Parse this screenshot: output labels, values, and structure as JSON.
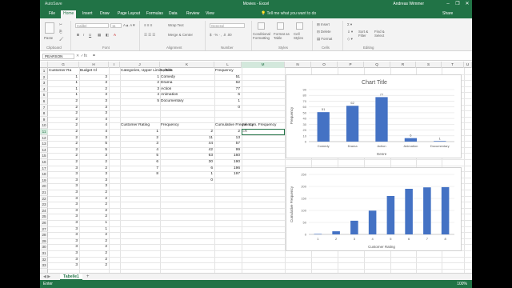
{
  "window": {
    "title": "Movies - Excel",
    "user": "Andreas Wimmer",
    "autosave": "AutoSave",
    "share": "Share",
    "tell_me": "Tell me what you want to do"
  },
  "ribbon_tabs": [
    "File",
    "Home",
    "Insert",
    "Draw",
    "Page Layout",
    "Formulas",
    "Data",
    "Review",
    "View"
  ],
  "ribbon": {
    "font_name": "Calibri",
    "font_size": "11",
    "number_format": "General",
    "wrap_text": "Wrap Text",
    "merge": "Merge & Center",
    "paste": "Paste",
    "conditional": "Conditional Formatting",
    "format_table": "Format as Table",
    "cell_styles": "Cell Styles",
    "insert": "Insert",
    "delete": "Delete",
    "format": "Format",
    "sort_filter": "Sort & Filter",
    "find_select": "Find & Select",
    "groups": [
      "Clipboard",
      "Font",
      "Alignment",
      "Number",
      "Styles",
      "Cells",
      "Editing"
    ]
  },
  "formula_bar": {
    "name_box": "PEARSON",
    "fx": "fx",
    "content": "="
  },
  "columns": [
    "G",
    "H",
    "I",
    "J",
    "K",
    "L",
    "M",
    "N",
    "O",
    "P",
    "Q",
    "R",
    "S",
    "T",
    "U"
  ],
  "rows": [
    "1",
    "2",
    "3",
    "4",
    "5",
    "6",
    "7",
    "8",
    "9",
    "10",
    "11",
    "12",
    "13",
    "14",
    "15",
    "16",
    "17",
    "18",
    "19",
    "20",
    "21",
    "22",
    "23",
    "24",
    "25",
    "26",
    "27",
    "28",
    "29",
    "30",
    "31",
    "32",
    "33"
  ],
  "headers": {
    "g1": "Customer Ra",
    "h1": "Budget Cl",
    "j1": "Categories, Upper Limits, Bins",
    "k1": "Labels",
    "l1": "Frequency",
    "j10": "Customer Rating",
    "k10": "Frequency",
    "l10": "Cumulative Frequency",
    "m10": "rel. cum. Frequency"
  },
  "customer_rating": [
    "1",
    "1",
    "1",
    "1",
    "2",
    "2",
    "2",
    "2",
    "2",
    "2",
    "2",
    "2",
    "2",
    "2",
    "2",
    "3",
    "3",
    "3",
    "3",
    "3",
    "3",
    "3",
    "3",
    "3",
    "3",
    "3",
    "3",
    "3",
    "3",
    "3",
    "3",
    "3"
  ],
  "budget_class": [
    "3",
    "3",
    "2",
    "3",
    "3",
    "3",
    "3",
    "4",
    "4",
    "4",
    "3",
    "5",
    "5",
    "3",
    "2",
    "2",
    "3",
    "3",
    "3",
    "2",
    "2",
    "2",
    "2",
    "2",
    "1",
    "1",
    "2",
    "2",
    "2",
    "2",
    "2",
    "2"
  ],
  "genre_table": {
    "bins": [
      "1",
      "2",
      "3",
      "4",
      "5"
    ],
    "labels": [
      "Comedy",
      "Drama",
      "Action",
      "Animation",
      "Documentary"
    ],
    "frequency": [
      "51",
      "62",
      "77",
      "6",
      "1",
      "0"
    ]
  },
  "rating_table": {
    "ratings": [
      "1",
      "2",
      "3",
      "4",
      "5",
      "6",
      "7",
      "8"
    ],
    "frequency": [
      "2",
      "11",
      "44",
      "42",
      "63",
      "30",
      "6",
      "1",
      "0"
    ],
    "cumulative": [
      "2",
      "13",
      "57",
      "99",
      "160",
      "190",
      "196",
      "197"
    ],
    "editing_cell": "=A"
  },
  "chart_data": [
    {
      "type": "bar",
      "title": "Chart Title",
      "categories": [
        "Comedy",
        "Drama",
        "Action",
        "Animation",
        "Documentary"
      ],
      "values": [
        51,
        62,
        77,
        6,
        1
      ],
      "xlabel": "Genre",
      "ylabel": "Frequency",
      "ylim": [
        0,
        90
      ],
      "yticks": [
        0,
        10,
        20,
        30,
        40,
        50,
        60,
        70,
        80,
        90
      ],
      "data_labels": true,
      "grid": true,
      "color": "#4472c4"
    },
    {
      "type": "bar",
      "title": "",
      "categories": [
        "1",
        "2",
        "3",
        "4",
        "5",
        "6",
        "7",
        "8"
      ],
      "values": [
        2,
        13,
        57,
        99,
        160,
        190,
        196,
        197
      ],
      "xlabel": "Customer Rating",
      "ylabel": "Cumulative Frequency",
      "ylim": [
        0,
        250
      ],
      "yticks": [
        0,
        50,
        100,
        150,
        200,
        250
      ],
      "data_labels": false,
      "grid": true,
      "color": "#4472c4"
    }
  ],
  "sheet": {
    "tab": "Tabelle1",
    "add": "+"
  },
  "status": {
    "mode": "Enter",
    "zoom": "100%"
  },
  "colors": {
    "excel_green": "#217346",
    "bar": "#4472c4"
  }
}
